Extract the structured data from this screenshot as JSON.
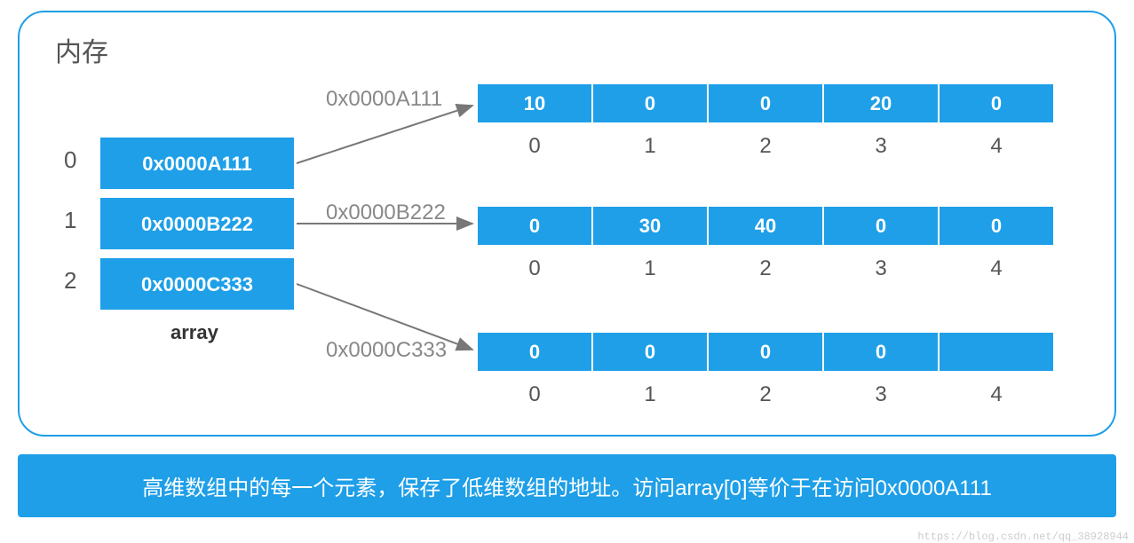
{
  "title": "内存",
  "array_label": "array",
  "pointer_array": {
    "indices": [
      "0",
      "1",
      "2"
    ],
    "cells": [
      "0x0000A111",
      "0x0000B222",
      "0x0000C333"
    ]
  },
  "rows": [
    {
      "addr": "0x0000A111",
      "values": [
        "10",
        "0",
        "0",
        "20",
        "0"
      ],
      "indices": [
        "0",
        "1",
        "2",
        "3",
        "4"
      ]
    },
    {
      "addr": "0x0000B222",
      "values": [
        "0",
        "30",
        "40",
        "0",
        "0"
      ],
      "indices": [
        "0",
        "1",
        "2",
        "3",
        "4"
      ]
    },
    {
      "addr": "0x0000C333",
      "values": [
        "0",
        "0",
        "0",
        "0",
        ""
      ],
      "indices": [
        "0",
        "1",
        "2",
        "3",
        "4"
      ]
    }
  ],
  "footer": "高维数组中的每一个元素，保存了低维数组的地址。访问array[0]等价于在访问0x0000A111",
  "watermark": "https://blog.csdn.net/qq_38928944"
}
